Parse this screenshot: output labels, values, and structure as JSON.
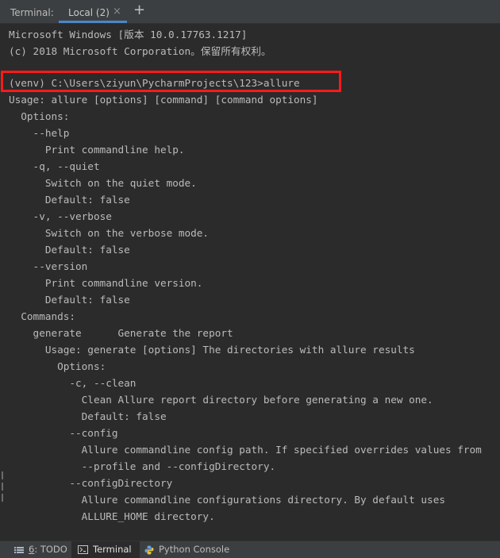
{
  "tool_window": {
    "title": "Terminal:",
    "active_tab": "Local (2)",
    "close_glyph": "×",
    "add_glyph": "+"
  },
  "terminal": {
    "lines": [
      "Microsoft Windows [版本 10.0.17763.1217]",
      "(c) 2018 Microsoft Corporation。保留所有权利。",
      "",
      "(venv) C:\\Users\\ziyun\\PycharmProjects\\123>allure",
      "Usage: allure [options] [command] [command options]",
      "  Options:",
      "    --help",
      "      Print commandline help.",
      "    -q, --quiet",
      "      Switch on the quiet mode.",
      "      Default: false",
      "    -v, --verbose",
      "      Switch on the verbose mode.",
      "      Default: false",
      "    --version",
      "      Print commandline version.",
      "      Default: false",
      "  Commands:",
      "    generate      Generate the report",
      "      Usage: generate [options] The directories with allure results",
      "        Options:",
      "          -c, --clean",
      "            Clean Allure report directory before generating a new one.",
      "            Default: false",
      "          --config",
      "            Allure commandline config path. If specified overrides values from",
      "            --profile and --configDirectory.",
      "          --configDirectory",
      "            Allure commandline configurations directory. By default uses",
      "            ALLURE_HOME directory."
    ],
    "highlighted_line_index": 3
  },
  "status_bar": {
    "todo_num": "6",
    "todo_label": ": TODO",
    "terminal_label": "Terminal",
    "python_console_label": "Python Console"
  },
  "colors": {
    "background": "#2b2b2b",
    "text": "#bbbbbb",
    "highlight_border": "#ff1a1a",
    "tab_underline": "#4a88c7"
  }
}
